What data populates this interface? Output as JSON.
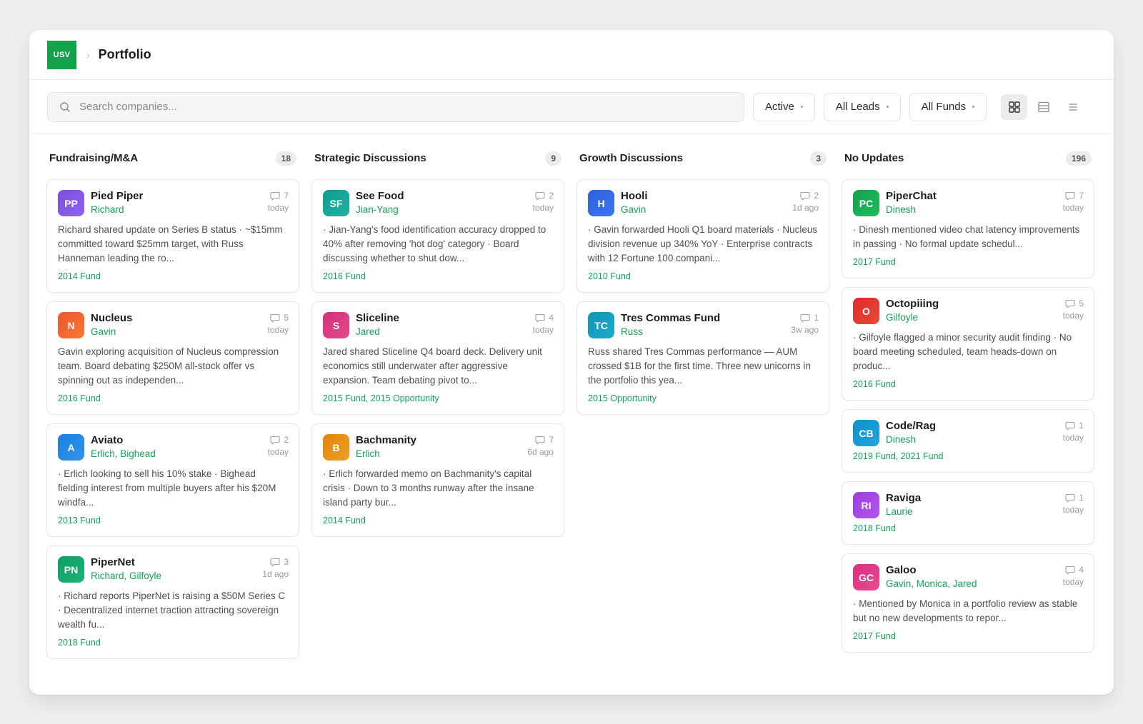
{
  "header": {
    "logo_text": "USV",
    "breadcrumb_sep": "›",
    "title": "Portfolio"
  },
  "toolbar": {
    "search_placeholder": "Search companies...",
    "filters": [
      "Active",
      "All Leads",
      "All Funds"
    ],
    "views": [
      "grid-view-icon",
      "table-view-icon",
      "list-view-icon"
    ],
    "active_view": "grid-view-icon"
  },
  "colors": {
    "accent_green": "#14a356",
    "logo_green": "#13a24a"
  },
  "columns": [
    {
      "title": "Fundraising/M&A",
      "count": "18",
      "cards": [
        {
          "initials": "PP",
          "name": "Pied Piper",
          "leads": "Richard",
          "comments": "7",
          "time": "today",
          "color": "#7c4ddf",
          "color2": "#8f63ee",
          "summary": "Richard shared update on Series B status · ~$15mm committed toward $25mm target, with Russ Hanneman leading the ro...",
          "funds": "2014 Fund"
        },
        {
          "initials": "N",
          "name": "Nucleus",
          "leads": "Gavin",
          "comments": "5",
          "time": "today",
          "color": "#f0542b",
          "color2": "#f67a35",
          "summary": "Gavin exploring acquisition of Nucleus compression team. Board debating $250M all-stock offer vs spinning out as independen...",
          "funds": "2016 Fund"
        },
        {
          "initials": "A",
          "name": "Aviato",
          "leads": "Erlich, Bighead",
          "comments": "2",
          "time": "today",
          "color": "#1c7fe0",
          "color2": "#2e95ec",
          "summary": "· Erlich looking to sell his 10% stake · Bighead fielding interest from multiple buyers after his $20M windfa...",
          "funds": "2013 Fund"
        },
        {
          "initials": "PN",
          "name": "PiperNet",
          "leads": "Richard, Gilfoyle",
          "comments": "3",
          "time": "1d ago",
          "color": "#0f9d63",
          "color2": "#1cb477",
          "summary": "· Richard reports PiperNet is raising a $50M Series C · Decentralized internet traction attracting sovereign wealth fu...",
          "funds": "2018 Fund"
        }
      ]
    },
    {
      "title": "Strategic Discussions",
      "count": "9",
      "cards": [
        {
          "initials": "SF",
          "name": "See Food",
          "leads": "Jian-Yang",
          "comments": "2",
          "time": "today",
          "color": "#119b8f",
          "color2": "#1fb3a4",
          "summary": "· Jian-Yang's food identification accuracy dropped to 40% after removing 'hot dog' category · Board discussing whether to shut dow...",
          "funds": "2016 Fund"
        },
        {
          "initials": "S",
          "name": "Sliceline",
          "leads": "Jared",
          "comments": "4",
          "time": "today",
          "color": "#d3307a",
          "color2": "#e34b8f",
          "summary": "Jared shared Sliceline Q4 board deck. Delivery unit economics still underwater after aggressive expansion. Team debating pivot to...",
          "funds": "2015 Fund, 2015 Opportunity"
        },
        {
          "initials": "B",
          "name": "Bachmanity",
          "leads": "Erlich",
          "comments": "7",
          "time": "6d ago",
          "color": "#e0840f",
          "color2": "#efa025",
          "summary": "· Erlich forwarded memo on Bachmanity's capital crisis · Down to 3 months runway after the insane island party bur...",
          "funds": "2014 Fund"
        }
      ]
    },
    {
      "title": "Growth Discussions",
      "count": "3",
      "cards": [
        {
          "initials": "H",
          "name": "Hooli",
          "leads": "Gavin",
          "comments": "2",
          "time": "1d ago",
          "color": "#2a5fe0",
          "color2": "#3d79ee",
          "summary": "· Gavin forwarded Hooli Q1 board materials · Nucleus division revenue up 340% YoY · Enterprise contracts with 12 Fortune 100 compani...",
          "funds": "2010 Fund"
        },
        {
          "initials": "TC",
          "name": "Tres Commas Fund",
          "leads": "Russ",
          "comments": "1",
          "time": "3w ago",
          "color": "#0e93b5",
          "color2": "#1eaccc",
          "summary": "Russ shared Tres Commas performance — AUM crossed $1B for the first time. Three new unicorns in the portfolio this yea...",
          "funds": "2015 Opportunity"
        }
      ]
    },
    {
      "title": "No Updates",
      "count": "196",
      "cards": [
        {
          "initials": "PC",
          "name": "PiperChat",
          "leads": "Dinesh",
          "comments": "7",
          "time": "today",
          "color": "#13a24a",
          "color2": "#22bb5c",
          "summary": "· Dinesh mentioned video chat latency improvements in passing · No formal update schedul...",
          "funds": "2017 Fund"
        },
        {
          "initials": "O",
          "name": "Octopiiing",
          "leads": "Gilfoyle",
          "comments": "5",
          "time": "today",
          "color": "#dc2a2a",
          "color2": "#ea4a3a",
          "summary": "· Gilfoyle flagged a minor security audit finding · No board meeting scheduled, team heads-down on produc...",
          "funds": "2016 Fund"
        },
        {
          "initials": "CB",
          "name": "Code/Rag",
          "leads": "Dinesh",
          "comments": "1",
          "time": "today",
          "color": "#0f8fc9",
          "color2": "#20a7de",
          "summary": "",
          "funds": "2019 Fund, 2021 Fund"
        },
        {
          "initials": "RI",
          "name": "Raviga",
          "leads": "Laurie",
          "comments": "1",
          "time": "today",
          "color": "#9a3de0",
          "color2": "#b257ee",
          "summary": "",
          "funds": "2018 Fund"
        },
        {
          "initials": "GC",
          "name": "Galoo",
          "leads": "Gavin, Monica, Jared",
          "comments": "4",
          "time": "today",
          "color": "#db2d7e",
          "color2": "#ea4b94",
          "summary": "· Mentioned by Monica in a portfolio review as stable but no new developments to repor...",
          "funds": "2017 Fund"
        }
      ]
    }
  ]
}
